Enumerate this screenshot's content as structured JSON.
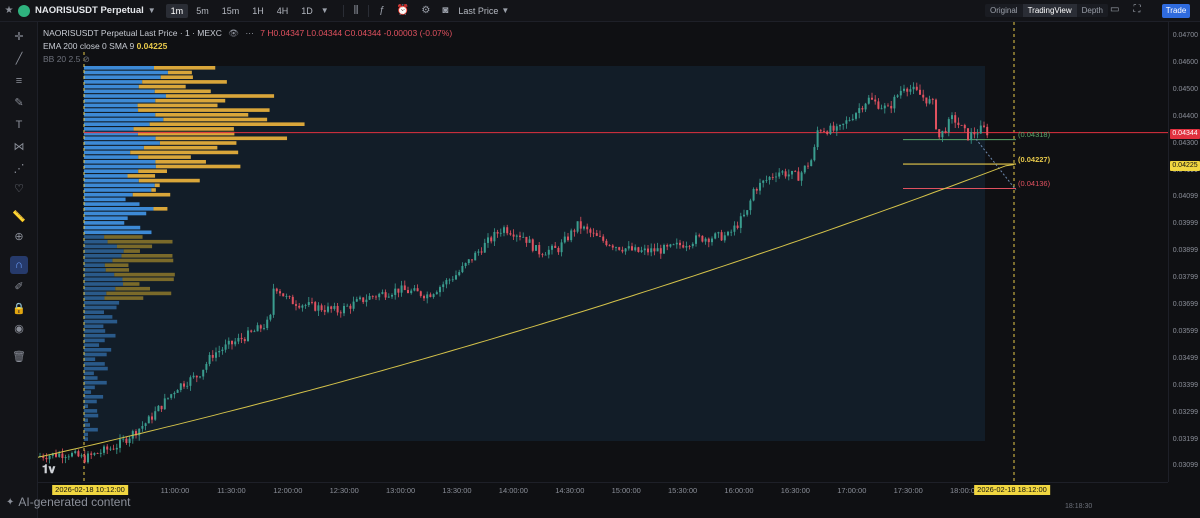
{
  "toolbar": {
    "symbol": "NAORISUSDT Perpetual",
    "timeframes": [
      "1m",
      "5m",
      "15m",
      "1H",
      "4H",
      "1D"
    ],
    "active_timeframe": "1m",
    "price_type": "Last Price",
    "views": [
      "Original",
      "TradingView",
      "Depth"
    ],
    "active_view": "TradingView",
    "trade_label": "Trade"
  },
  "legend": {
    "line1_title": "NAORISUSDT Perpetual Last Price · 1 · MEXC",
    "line1_ohlc": "7 H0.04347 L0.04344 C0.04344 -0.00003 (-0.07%)",
    "line2_label": "EMA 200 close 0 SMA 9",
    "line2_value": "0.04225",
    "line3_label": "BB 20 2.5"
  },
  "price_axis": {
    "ticks": [
      "0.04700",
      "0.04600",
      "0.04500",
      "0.04400",
      "0.04300",
      "0.04199",
      "0.04099",
      "0.03999",
      "0.03899",
      "0.03799",
      "0.03699",
      "0.03599",
      "0.03499",
      "0.03399",
      "0.03299",
      "0.03199",
      "0.03099"
    ],
    "last_price_label": "0.04344",
    "ema_label": "0.04225"
  },
  "fib_levels": {
    "upper": "(0.04318)",
    "mid": "(0.04227)",
    "lower": "(0.04136)"
  },
  "time_axis": {
    "ticks": [
      "11:00:00",
      "11:30:00",
      "12:00:00",
      "12:30:00",
      "13:00:00",
      "13:30:00",
      "14:00:00",
      "14:30:00",
      "15:00:00",
      "15:30:00",
      "16:00:00",
      "16:30:00",
      "17:00:00",
      "17:30:00",
      "18:00:00"
    ],
    "start_label": "2026-02-18  10:12:00",
    "end_label": "2026-02-18  18:12:00"
  },
  "bottom_right_label": "18:18:30",
  "watermark": "AI-generated content",
  "colors": {
    "up": "#3a9d8f",
    "down": "#e0515f",
    "ema": "#d4c24a",
    "last_price": "#e0313f",
    "accent": "#2f6bde"
  }
}
